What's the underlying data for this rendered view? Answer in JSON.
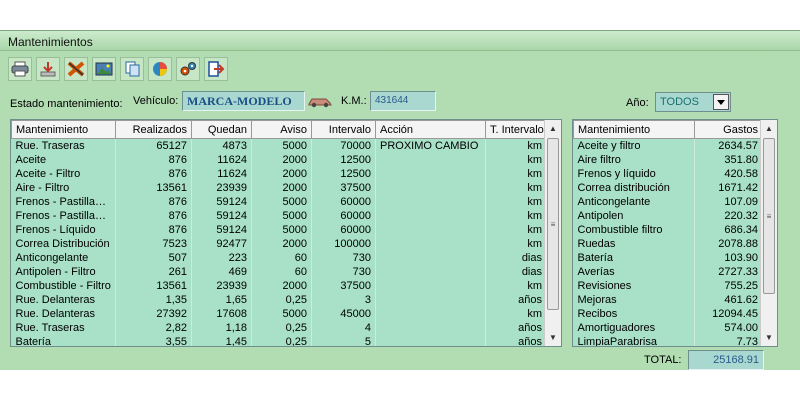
{
  "window": {
    "title": "Mantenimientos"
  },
  "toolbar": {
    "icons": [
      "printer-icon",
      "download-icon",
      "tools-icon",
      "image-icon",
      "copy-icon",
      "chart-icon",
      "settings-icon",
      "exit-icon"
    ]
  },
  "filters": {
    "estado_label": "Estado mantenimiento:",
    "vehiculo_label": "Vehículo:",
    "vehiculo_value": "MARCA-MODELO",
    "km_label": "K.M.:",
    "km_value": "431644",
    "anio_label": "Año:",
    "anio_value": "TODOS"
  },
  "main_table": {
    "columns": [
      "Mantenimiento",
      "Realizados",
      "Quedan",
      "Aviso",
      "Intervalo",
      "Acción",
      "T. Intervalo"
    ],
    "rows": [
      [
        "Rue. Traseras",
        "65127",
        "4873",
        "5000",
        "70000",
        "PROXIMO CAMBIO",
        "km"
      ],
      [
        "Aceite",
        "876",
        "11624",
        "2000",
        "12500",
        "",
        "km"
      ],
      [
        "Aceite - Filtro",
        "876",
        "11624",
        "2000",
        "12500",
        "",
        "km"
      ],
      [
        "Aire - Filtro",
        "13561",
        "23939",
        "2000",
        "37500",
        "",
        "km"
      ],
      [
        "Frenos - Pastillas ...",
        "876",
        "59124",
        "5000",
        "60000",
        "",
        "km"
      ],
      [
        "Frenos - Pastillas ...",
        "876",
        "59124",
        "5000",
        "60000",
        "",
        "km"
      ],
      [
        "Frenos - Líquido",
        "876",
        "59124",
        "5000",
        "60000",
        "",
        "km"
      ],
      [
        "Correa Distribución",
        "7523",
        "92477",
        "2000",
        "100000",
        "",
        "km"
      ],
      [
        "Anticongelante",
        "507",
        "223",
        "60",
        "730",
        "",
        "dias"
      ],
      [
        "Antipolen - Filtro",
        "261",
        "469",
        "60",
        "730",
        "",
        "dias"
      ],
      [
        "Combustible - Filtro",
        "13561",
        "23939",
        "2000",
        "37500",
        "",
        "km"
      ],
      [
        "Rue. Delanteras",
        "1,35",
        "1,65",
        "0,25",
        "3",
        "",
        "años"
      ],
      [
        "Rue. Delanteras",
        "27392",
        "17608",
        "5000",
        "45000",
        "",
        "km"
      ],
      [
        "Rue. Traseras",
        "2,82",
        "1,18",
        "0,25",
        "4",
        "",
        "años"
      ],
      [
        "Batería",
        "3,55",
        "1,45",
        "0,25",
        "5",
        "",
        "años"
      ]
    ]
  },
  "gastos_table": {
    "columns": [
      "Mantenimiento",
      "Gastos"
    ],
    "rows": [
      [
        "Aceite y filtro",
        "2634.57"
      ],
      [
        "Aire filtro",
        "351.80"
      ],
      [
        "Frenos y líquido",
        "420.58"
      ],
      [
        "Correa distribución",
        "1671.42"
      ],
      [
        "Anticongelante",
        "107.09"
      ],
      [
        "Antipolen",
        "220.32"
      ],
      [
        "Combustible filtro",
        "686.34"
      ],
      [
        "Ruedas",
        "2078.88"
      ],
      [
        "Batería",
        "103.90"
      ],
      [
        "Averías",
        "2727.33"
      ],
      [
        "Revisiones",
        "755.25"
      ],
      [
        "Mejoras",
        "461.62"
      ],
      [
        "Recibos",
        "12094.45"
      ],
      [
        "Amortiguadores",
        "574.00"
      ],
      [
        "LimpiaParabrisa",
        "7.73"
      ]
    ]
  },
  "total": {
    "label": "TOTAL:",
    "value": "25168.91"
  }
}
